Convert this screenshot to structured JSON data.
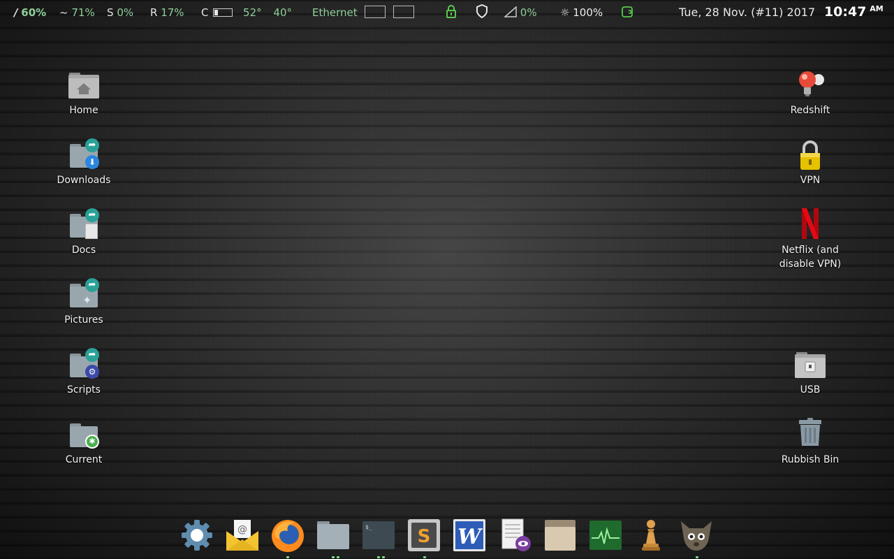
{
  "panel": {
    "root": {
      "label": "/",
      "value": "60%"
    },
    "home": {
      "label": "~",
      "value": "71%"
    },
    "swap": {
      "label": "S",
      "value": "0%"
    },
    "ram": {
      "label": "R",
      "value": "17%"
    },
    "cpu": {
      "label": "C",
      "bar_fraction": 0.2,
      "temp1": "52°",
      "temp2": "40°"
    },
    "network": {
      "label": "Ethernet"
    },
    "volume": {
      "value": "0%"
    },
    "brightness": {
      "value": "100%"
    },
    "clock": {
      "date": "Tue, 28 Nov. (#11) 2017",
      "time": "10:47",
      "ampm": "AM"
    }
  },
  "desktop": {
    "left_icons": [
      {
        "label": "Home",
        "icon": "home-folder-icon"
      },
      {
        "label": "Downloads",
        "icon": "downloads-folder-icon"
      },
      {
        "label": "Docs",
        "icon": "docs-folder-icon"
      },
      {
        "label": "Pictures",
        "icon": "pictures-folder-icon"
      },
      {
        "label": "Scripts",
        "icon": "scripts-folder-icon"
      },
      {
        "label": "Current",
        "icon": "current-folder-icon"
      }
    ],
    "right_icons": [
      {
        "label": "Redshift",
        "icon": "redshift-lightbulb-icon"
      },
      {
        "label": "VPN",
        "icon": "padlock-icon"
      },
      {
        "label": "Netflix (and disable VPN)",
        "label_line1": "Netflix (and",
        "label_line2": "disable VPN)",
        "icon": "netflix-icon"
      },
      {
        "label": "USB",
        "icon": "usb-drive-icon"
      },
      {
        "label": "Rubbish Bin",
        "icon": "trash-bin-icon"
      }
    ]
  },
  "dock": {
    "items": [
      {
        "name": "settings",
        "icon": "gear-icon"
      },
      {
        "name": "mail",
        "icon": "mail-envelope-icon"
      },
      {
        "name": "firefox",
        "icon": "firefox-icon"
      },
      {
        "name": "files",
        "icon": "folder-icon"
      },
      {
        "name": "terminal",
        "icon": "terminal-icon"
      },
      {
        "name": "sublime-text",
        "icon": "sublime-text-icon",
        "glyph": "S"
      },
      {
        "name": "word",
        "icon": "word-icon",
        "glyph": "W"
      },
      {
        "name": "document-viewer",
        "icon": "document-viewer-icon"
      },
      {
        "name": "archive-manager",
        "icon": "archive-box-icon"
      },
      {
        "name": "system-monitor",
        "icon": "system-monitor-icon"
      },
      {
        "name": "chess",
        "icon": "chess-pawn-icon"
      },
      {
        "name": "gimp",
        "icon": "gimp-icon"
      }
    ]
  },
  "colors": {
    "panel_value": "#8fcf9a",
    "accent_green": "#57c84d",
    "teal_badge": "#2aa198"
  }
}
